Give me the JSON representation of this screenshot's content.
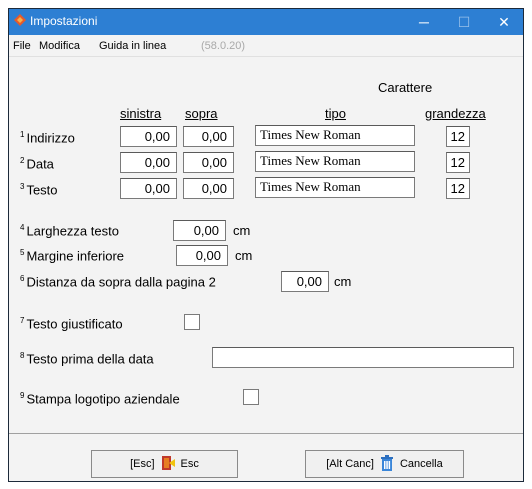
{
  "window": {
    "title": "Impostazioni",
    "minimize": "─",
    "maximize": "☐",
    "close": "✕"
  },
  "menu": {
    "file": "File",
    "modifica": "Modifica",
    "guida": "Guida in linea",
    "version": "(58.0.20)"
  },
  "header": {
    "carattere": "Carattere",
    "sinistra": "sinistra",
    "sopra": "sopra",
    "tipo": "tipo",
    "grandezza": "grandezza"
  },
  "rows": [
    {
      "num": "1",
      "label": "Indirizzo",
      "sinistra": "0,00",
      "sopra": "0,00",
      "tipo": "Times New Roman",
      "grandezza": "12"
    },
    {
      "num": "2",
      "label": "Data",
      "sinistra": "0,00",
      "sopra": "0,00",
      "tipo": "Times New Roman",
      "grandezza": "12"
    },
    {
      "num": "3",
      "label": "Testo",
      "sinistra": "0,00",
      "sopra": "0,00",
      "tipo": "Times New Roman",
      "grandezza": "12"
    }
  ],
  "settings": {
    "larghezza": {
      "num": "4",
      "label": "Larghezza testo",
      "value": "0,00",
      "unit": "cm"
    },
    "margine": {
      "num": "5",
      "label": "Margine inferiore",
      "value": "0,00",
      "unit": "cm"
    },
    "distanza": {
      "num": "6",
      "label": "Distanza da sopra dalla pagina 2",
      "value": "0,00",
      "unit": "cm"
    },
    "giustificato": {
      "num": "7",
      "label": "Testo giustificato",
      "checked": false
    },
    "prima_data": {
      "num": "8",
      "label": "Testo prima della data",
      "value": ""
    },
    "logotipo": {
      "num": "9",
      "label": "Stampa logotipo aziendale",
      "checked": false
    }
  },
  "buttons": {
    "esc_shortcut": "[Esc]",
    "esc_label": "Esc",
    "cancel_shortcut": "[Alt Canc]",
    "cancel_label": "Cancella"
  },
  "colors": {
    "titlebar": "#2d7fd3",
    "window_bg": "#f3f3f3"
  }
}
